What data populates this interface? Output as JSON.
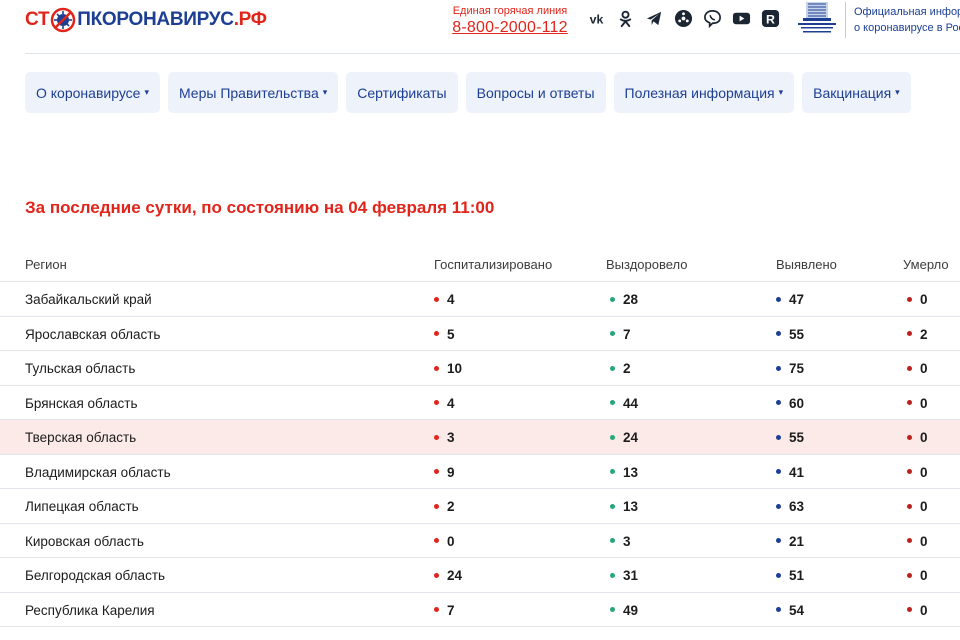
{
  "logo": {
    "part1": "СТ",
    "part2": "ПКОРОНАВИРУС",
    "part3": ".РФ"
  },
  "hotline": {
    "caption": "Единая горячая линия",
    "number": "8-800-2000-112"
  },
  "socials": [
    "vk-icon",
    "ok-icon",
    "telegram-icon",
    "tiktok-icon",
    "viber-icon",
    "youtube-icon",
    "rutube-icon"
  ],
  "gov": {
    "line1": "Официальная информ",
    "line2": "о коронавирусе в Рос"
  },
  "nav": [
    {
      "label": "О коронавирусе",
      "arrow": "▾"
    },
    {
      "label": "Меры Правительства",
      "arrow": "▾"
    },
    {
      "label": "Сертификаты",
      "arrow": ""
    },
    {
      "label": "Вопросы и ответы",
      "arrow": ""
    },
    {
      "label": "Полезная информация",
      "arrow": "▾"
    },
    {
      "label": "Вакцинация",
      "arrow": "▾"
    }
  ],
  "update_title": "За последние сутки, по состоянию на 04 февраля 11:00",
  "table": {
    "headers": [
      "Регион",
      "Госпитализировано",
      "Выздоровело",
      "Выявлено",
      "Умерло"
    ],
    "rows": [
      {
        "region": "Забайкальский край",
        "hospitalized": "4",
        "recovered": "28",
        "detected": "47",
        "died": "0"
      },
      {
        "region": "Ярославская область",
        "hospitalized": "5",
        "recovered": "7",
        "detected": "55",
        "died": "2"
      },
      {
        "region": "Тульская область",
        "hospitalized": "10",
        "recovered": "2",
        "detected": "75",
        "died": "0"
      },
      {
        "region": "Брянская область",
        "hospitalized": "4",
        "recovered": "44",
        "detected": "60",
        "died": "0"
      },
      {
        "region": "Тверская область",
        "hospitalized": "3",
        "recovered": "24",
        "detected": "55",
        "died": "0",
        "highlighted": true
      },
      {
        "region": "Владимирская область",
        "hospitalized": "9",
        "recovered": "13",
        "detected": "41",
        "died": "0"
      },
      {
        "region": "Липецкая область",
        "hospitalized": "2",
        "recovered": "13",
        "detected": "63",
        "died": "0"
      },
      {
        "region": "Кировская область",
        "hospitalized": "0",
        "recovered": "3",
        "detected": "21",
        "died": "0"
      },
      {
        "region": "Белгородская область",
        "hospitalized": "24",
        "recovered": "31",
        "detected": "51",
        "died": "0"
      },
      {
        "region": "Республика Карелия",
        "hospitalized": "7",
        "recovered": "49",
        "detected": "54",
        "died": "0"
      }
    ]
  },
  "colors": {
    "brand_red": "#e1251b",
    "brand_blue": "#1c3f94",
    "dot_hospitalized": "#e1251b",
    "dot_recovered": "#27a67a",
    "dot_detected": "#1c3f94",
    "dot_died": "#c0201a",
    "highlight_row": "#fbeae8"
  }
}
